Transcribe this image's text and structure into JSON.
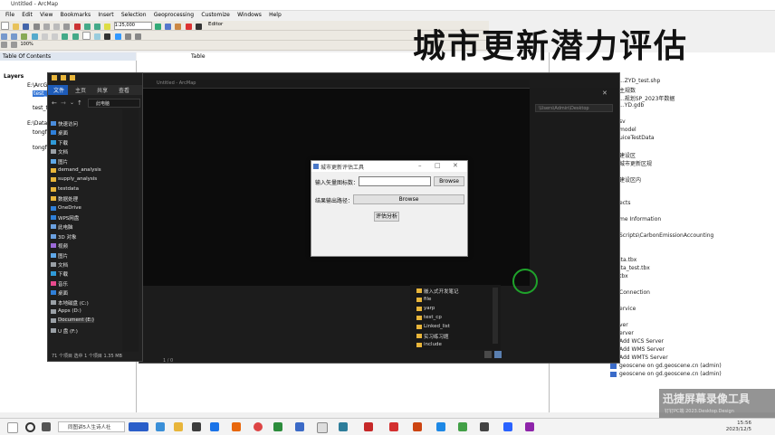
{
  "arcmap": {
    "window_title": "Untitled - ArcMap",
    "menu": [
      "File",
      "Edit",
      "View",
      "Bookmarks",
      "Insert",
      "Selection",
      "Geoprocessing",
      "Customize",
      "Windows",
      "Help"
    ],
    "scale": "1:25,000",
    "editor_label": "Editor",
    "zoom": "100%",
    "toc_title": "Table Of Contents",
    "table_label": "Table",
    "toc_items": [
      "Layers",
      "E:\\ArcGIS",
      "test_ths",
      "test_ths",
      "E:\\Data\\gis",
      "tongfa",
      "tongfa"
    ]
  },
  "overlay_title": "城市更新潜力评估",
  "catalog": {
    "items": [
      "...ZYD_test.shp",
      "主规数",
      "...规划SP_2023年数据",
      "...YD.gdb",
      "",
      "sv",
      "model",
      "uiceTestData",
      "",
      "建设区",
      "城市更新区规",
      "",
      "建设区内",
      "",
      "",
      "ects",
      "",
      "me Information",
      "",
      "Scripts\\CarbonEmissionAccounting",
      "",
      "",
      "ita.tbx",
      "ita_test.tbx",
      "tbx",
      "",
      "Connection",
      "",
      "ervice",
      "",
      "ver",
      "erver",
      "Add WCS Server",
      "Add WMS Server",
      "Add WMTS Server",
      "geoscene on gd.geoscene.cn (admin)",
      "geoscene on gd.geoscene.cn (admin)"
    ]
  },
  "explorer": {
    "tabs": [
      "文件",
      "主页",
      "共享",
      "查看"
    ],
    "address": "此电脑",
    "nav_items": [
      "快速访问",
      "桌面",
      "下载",
      "文档",
      "图片",
      "demand_analysis",
      "supply_analysis",
      "testdata",
      "数据处理",
      "OneDrive",
      "WPS网盘",
      "此电脑",
      "3D 对象",
      "视频",
      "图片",
      "文档",
      "下载",
      "音乐",
      "桌面",
      "本地磁盘 (C:)",
      "Apps (D:)",
      "Document (E:)",
      "U 盘 (F:)"
    ],
    "status": "71 个项目  选中 1 个项目 1.35 MB"
  },
  "editor": {
    "title": "Untitled - ArcMap",
    "search_placeholder": "\\Users\\Admin\\Desktop",
    "files": [
      "嵌入式开发笔记",
      "file",
      "yarp",
      "test_cp",
      "Linked_list",
      "实习练习题",
      "include"
    ],
    "status": "1 / 0"
  },
  "dialog": {
    "title": "城市更新评估工具",
    "input_label": "输入矢量图标数：",
    "input_value": "",
    "browse_top": "Browse",
    "output_label": "结果输出路径：",
    "browse_bottom": "Browse",
    "run_button": "评估分析"
  },
  "watermark": {
    "line1": "迅捷屏幕录像工具",
    "line2": "钉钉PC端 2023.Desktop.Design"
  },
  "taskbar": {
    "search_text": "同图讲5人生诗人社",
    "clock_time": "15:56",
    "clock_date": "2023/12/5"
  },
  "colors": {
    "title_text": "#111111",
    "dark_bg": "#0c0c0c",
    "cursor_ring": "#1fa32b"
  }
}
